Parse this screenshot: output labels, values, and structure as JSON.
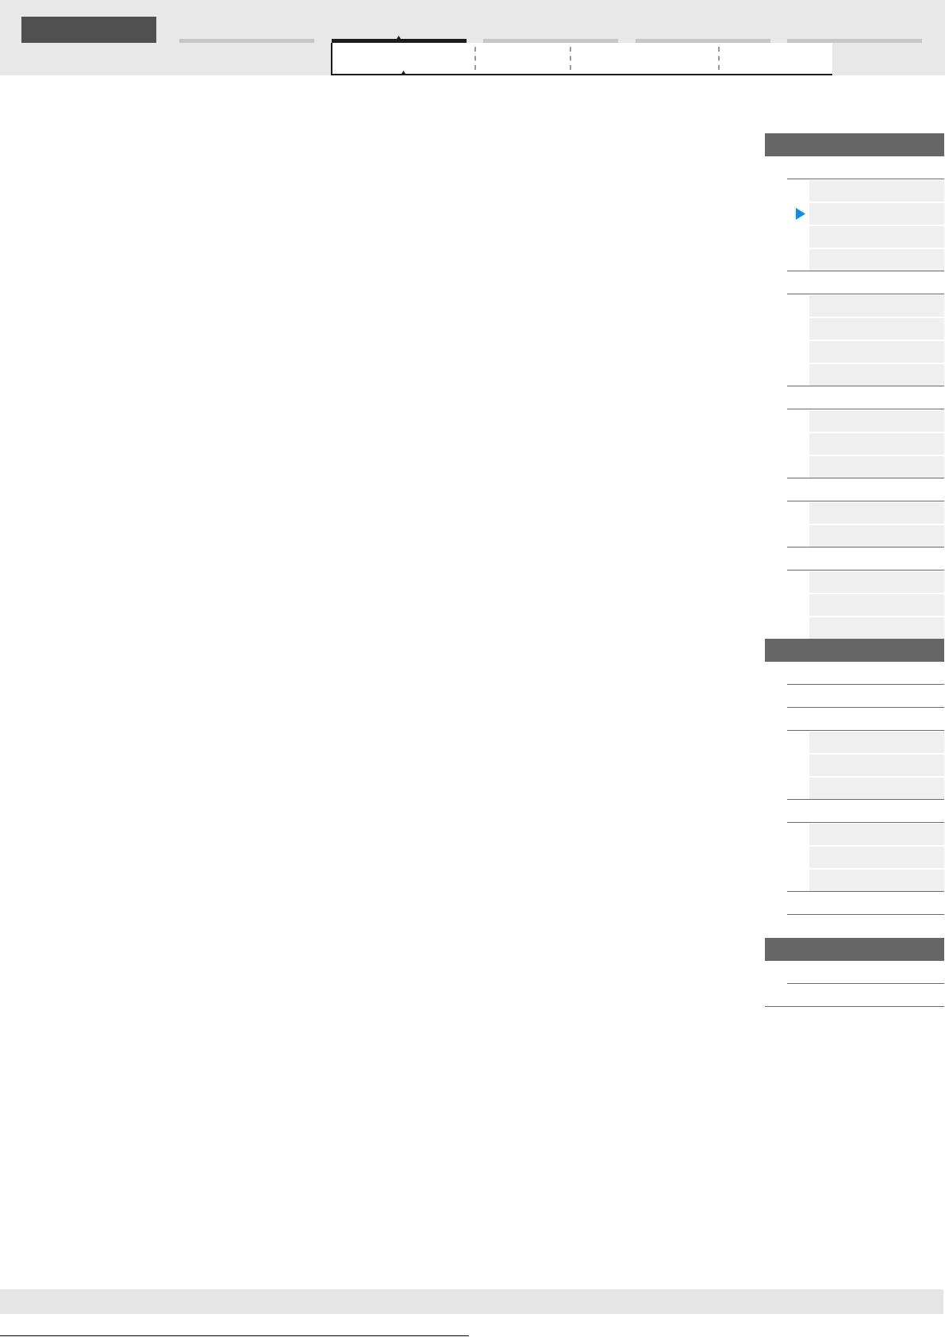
{
  "header": {
    "tabs": [
      {
        "selected": false
      },
      {
        "selected": true
      },
      {
        "selected": false
      },
      {
        "selected": false
      },
      {
        "selected": false
      }
    ]
  },
  "subtabs": [
    {
      "selected": true
    },
    {
      "selected": false
    },
    {
      "selected": false
    },
    {
      "selected": false
    }
  ],
  "sidebar": {
    "sections": [
      {
        "items": [
          {
            "selected": false,
            "children": [
              {
                "selected": false
              },
              {
                "selected": true
              },
              {
                "selected": false
              },
              {
                "selected": false
              }
            ]
          },
          {
            "selected": false,
            "children": [
              {
                "selected": false
              },
              {
                "selected": false
              },
              {
                "selected": false
              },
              {
                "selected": false
              }
            ]
          },
          {
            "selected": false,
            "children": [
              {
                "selected": false
              },
              {
                "selected": false
              },
              {
                "selected": false
              }
            ]
          },
          {
            "selected": false,
            "children": [
              {
                "selected": false
              },
              {
                "selected": false
              }
            ]
          },
          {
            "selected": false,
            "children": [
              {
                "selected": false
              },
              {
                "selected": false
              },
              {
                "selected": false
              }
            ]
          }
        ]
      },
      {
        "items": [
          {
            "selected": false
          },
          {
            "selected": false
          },
          {
            "selected": false,
            "children": [
              {
                "selected": false
              },
              {
                "selected": false
              },
              {
                "selected": false
              }
            ]
          },
          {
            "selected": false,
            "children": [
              {
                "selected": false
              },
              {
                "selected": false
              },
              {
                "selected": false
              }
            ]
          },
          {
            "selected": false
          }
        ]
      },
      {
        "items": [
          {
            "selected": false
          },
          {
            "selected": false
          }
        ]
      }
    ]
  }
}
